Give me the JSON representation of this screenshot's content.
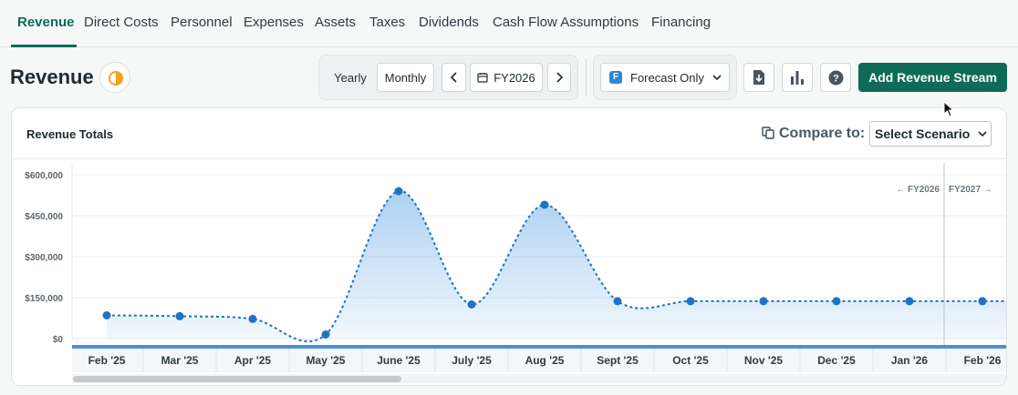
{
  "tabs": [
    {
      "label": "Revenue",
      "active": true
    },
    {
      "label": "Direct Costs"
    },
    {
      "label": "Personnel"
    },
    {
      "label": "Expenses"
    },
    {
      "label": "Assets"
    },
    {
      "label": "Taxes"
    },
    {
      "label": "Dividends"
    },
    {
      "label": "Cash Flow Assumptions"
    },
    {
      "label": "Financing"
    }
  ],
  "header": {
    "title": "Revenue",
    "period_toggle": {
      "yearly": "Yearly",
      "monthly": "Monthly",
      "selected": "Monthly"
    },
    "fiscal_year": "FY2026",
    "view_filter": {
      "badge": "F",
      "label": "Forecast Only"
    },
    "icons": [
      "download-icon",
      "bar-chart-icon",
      "help-icon"
    ],
    "primary_action": "Add Revenue Stream",
    "accent": "#0f6b57"
  },
  "card": {
    "title": "Revenue Totals",
    "compare_label": "Compare to:",
    "scenario_select": "Select Scenario"
  },
  "chart_data": {
    "type": "area",
    "categories": [
      "Feb '25",
      "Mar '25",
      "Apr '25",
      "May '25",
      "June '25",
      "July '25",
      "Aug '25",
      "Sept '25",
      "Oct '25",
      "Nov '25",
      "Dec '25",
      "Jan '26",
      "Feb '26"
    ],
    "values": [
      85000,
      82000,
      72000,
      15000,
      540000,
      125000,
      490000,
      137000,
      137000,
      137000,
      137000,
      137000,
      137000
    ],
    "y_ticks": [
      "$600,000",
      "$450,000",
      "$300,000",
      "$150,000",
      "$0"
    ],
    "ylim": [
      0,
      600000
    ],
    "fiscal_markers": {
      "left": "← FY2026",
      "right": "FY2027 →"
    },
    "line_style": "dotted",
    "series_color": "#1f73c4",
    "fill_color": "#9ec8ef",
    "grid": true
  }
}
